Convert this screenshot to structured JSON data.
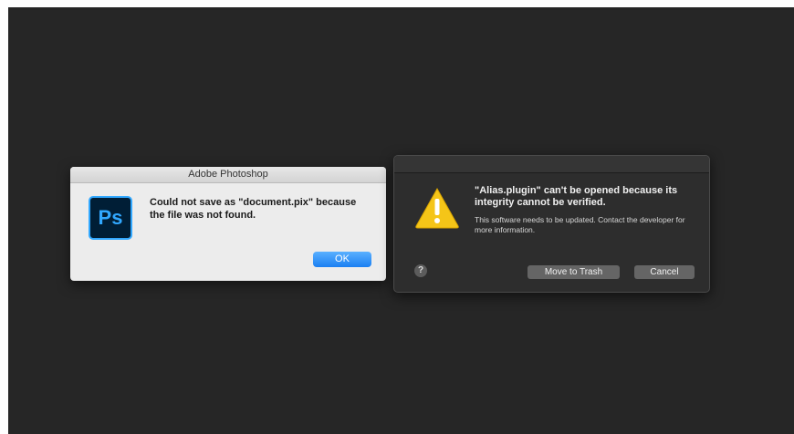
{
  "photoshop_dialog": {
    "title": "Adobe Photoshop",
    "icon_text": "Ps",
    "message": "Could not save as \"document.pix\" because the file was not found.",
    "ok_label": "OK"
  },
  "mac_alert": {
    "heading": "\"Alias.plugin\" can't be opened because its integrity cannot be verified.",
    "body": "This software needs to be updated. Contact the developer for more information.",
    "help_label": "?",
    "move_to_trash_label": "Move to Trash",
    "cancel_label": "Cancel"
  },
  "icons": {
    "ps_app": "photoshop-app-icon",
    "warning": "warning-triangle-icon",
    "help": "help-icon"
  },
  "colors": {
    "desktop_background": "#262626",
    "ok_button": "#1a7ff2",
    "ps_icon_accent": "#31a8ff",
    "warning_yellow": "#f5c518"
  }
}
